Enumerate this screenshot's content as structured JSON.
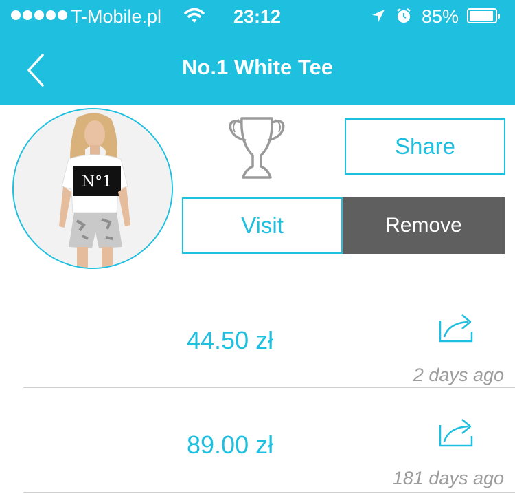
{
  "status_bar": {
    "carrier": "T-Mobile.pl",
    "time": "23:12",
    "battery": "85%",
    "battery_level": 0.85,
    "signal_icon": "signal-dots-icon",
    "wifi_icon": "wifi-icon",
    "location_icon": "location-arrow-icon",
    "alarm_icon": "alarm-icon"
  },
  "header": {
    "title": "No.1 White Tee",
    "back_icon": "chevron-left-icon"
  },
  "product": {
    "image_label": "N°1",
    "trophy_icon": "trophy-icon"
  },
  "actions": {
    "share": "Share",
    "visit": "Visit",
    "remove": "Remove"
  },
  "price_history": [
    {
      "price": "44.50 zł",
      "age": "2 days ago"
    },
    {
      "price": "89.00 zł",
      "age": "181 days ago"
    }
  ],
  "colors": {
    "accent": "#1ebfdf",
    "remove_bg": "#5f5f5f",
    "muted_text": "#9c9c9c"
  }
}
